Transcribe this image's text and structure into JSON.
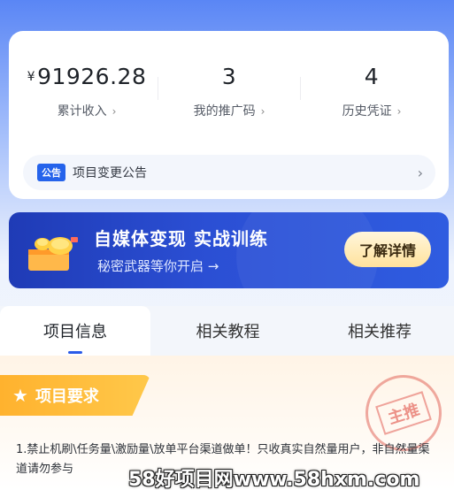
{
  "stats": {
    "items": [
      {
        "prefix": "¥",
        "value": "91926.28",
        "label": "累计收入"
      },
      {
        "prefix": "",
        "value": "3",
        "label": "我的推广码"
      },
      {
        "prefix": "",
        "value": "4",
        "label": "历史凭证"
      }
    ]
  },
  "notice": {
    "tag": "公告",
    "text": "项目变更公告"
  },
  "banner": {
    "title": "自媒体变现 实战训练",
    "subtitle": "秘密武器等你开启 →",
    "button_label": "了解详情"
  },
  "tabs": [
    {
      "label": "项目信息",
      "active": true
    },
    {
      "label": "相关教程",
      "active": false
    },
    {
      "label": "相关推荐",
      "active": false
    }
  ],
  "section": {
    "title": "项目要求",
    "stamp_text": "主推",
    "description": "1.禁止机刷\\任务量\\激励量\\放单平台渠道做单！只收真实自然量用户，非自然量渠道请勿参与"
  },
  "watermark": "58好项目网www.58hxm.com",
  "colors": {
    "accent": "#2563eb",
    "banner": "#2b4fd4",
    "tag_orange": "#ffb22e"
  }
}
